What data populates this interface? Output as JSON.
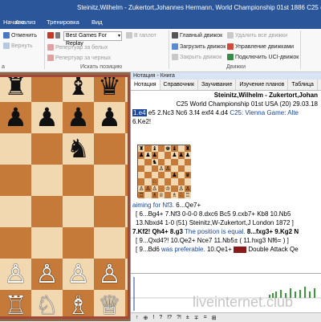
{
  "window": {
    "title": "Steinitz,Wilhelm - Zukertort,Johannes Hermann, World Championship 01st 1886  C25  (Tactical Analysis 2.10 (10s)), 1-0 - "
  },
  "tabs": [
    {
      "label": "Начало"
    },
    {
      "label": "Анализ"
    },
    {
      "label": "Тренировка"
    },
    {
      "label": "Вид"
    }
  ],
  "ribbon": {
    "undo_label": "Отменить",
    "redo_label": "Вернуть",
    "book_combo_value": "Best Games For Replay",
    "in_library_label": "В гаплот",
    "repertoire_white_label": "Репертуар за белых",
    "repertoire_black_label": "Репертуар за черных",
    "search_group_label": "Искать позицию",
    "main_engine_label": "Главный движок",
    "load_engine_label": "Загрузить движок",
    "close_engine_label": "Закрыть движок",
    "delete_all_engines_label": "Удалить все движки",
    "engine_management_label": "Управление движками",
    "uci_connect_label": "Подключить UCI-движок",
    "engines_group_label": "Движки",
    "left_group_label": "а"
  },
  "notation_panel": {
    "title": "Нотация - Книга",
    "tabs": [
      "Нотация",
      "Справочник",
      "Заучивание",
      "Изучение планов",
      "Таблица",
      "Бл"
    ],
    "players": "Steinitz,Wilhelm - Zukertort,Johan",
    "event": "C25 World Championship 01st USA (20) 29.03.18",
    "line1_moves": [
      "1.e4",
      "e5",
      "2.Nc3",
      "Nc6",
      "3.f4",
      "exf4",
      "4.d4"
    ],
    "line1_comment": "C25: Vienna Game: Alte",
    "line2": "6.Ke2!",
    "comment1": "aiming for Nf3.",
    "comment1_move": "6...Qe7+",
    "var1": "[ 6...Bg4+ 7.Nf3 0-0-0 8.dxc6 Bc5 9.cxb7+ Kb8 10.Nb5",
    "var1b": "13.Nbxd4 1-0 (51) Steinitz,W-Zukertort,J London 1872 ]",
    "main2": "7.Kf2! Qh4+ 8.g3",
    "main2_comment": "The position is equal.",
    "main2_tail": "8...fxg3+ 9.Kg2 N",
    "var2": "[ 9...Qxd4?! 10.Qe2+ Nce7 11.Nb5± ( 11.hxg3 Nf6= ) ]",
    "var3_start": "[ 9...Bd6",
    "var3_comment": "was preferable.",
    "var3_tail": "10.Qe1+",
    "var3_tag": "Double Attack",
    "var3_end": "Qe"
  },
  "eval_toolbar": [
    "↑",
    "⊕",
    "!",
    "?",
    "!?",
    "?!",
    "±",
    "∓",
    "=",
    "⊞"
  ],
  "watermark": "liveinternet.club",
  "colors": {
    "accent": "#2b579a",
    "light_square": "#f1d8b0",
    "dark_square": "#c57a3a",
    "board_frame": "#a3473a"
  }
}
